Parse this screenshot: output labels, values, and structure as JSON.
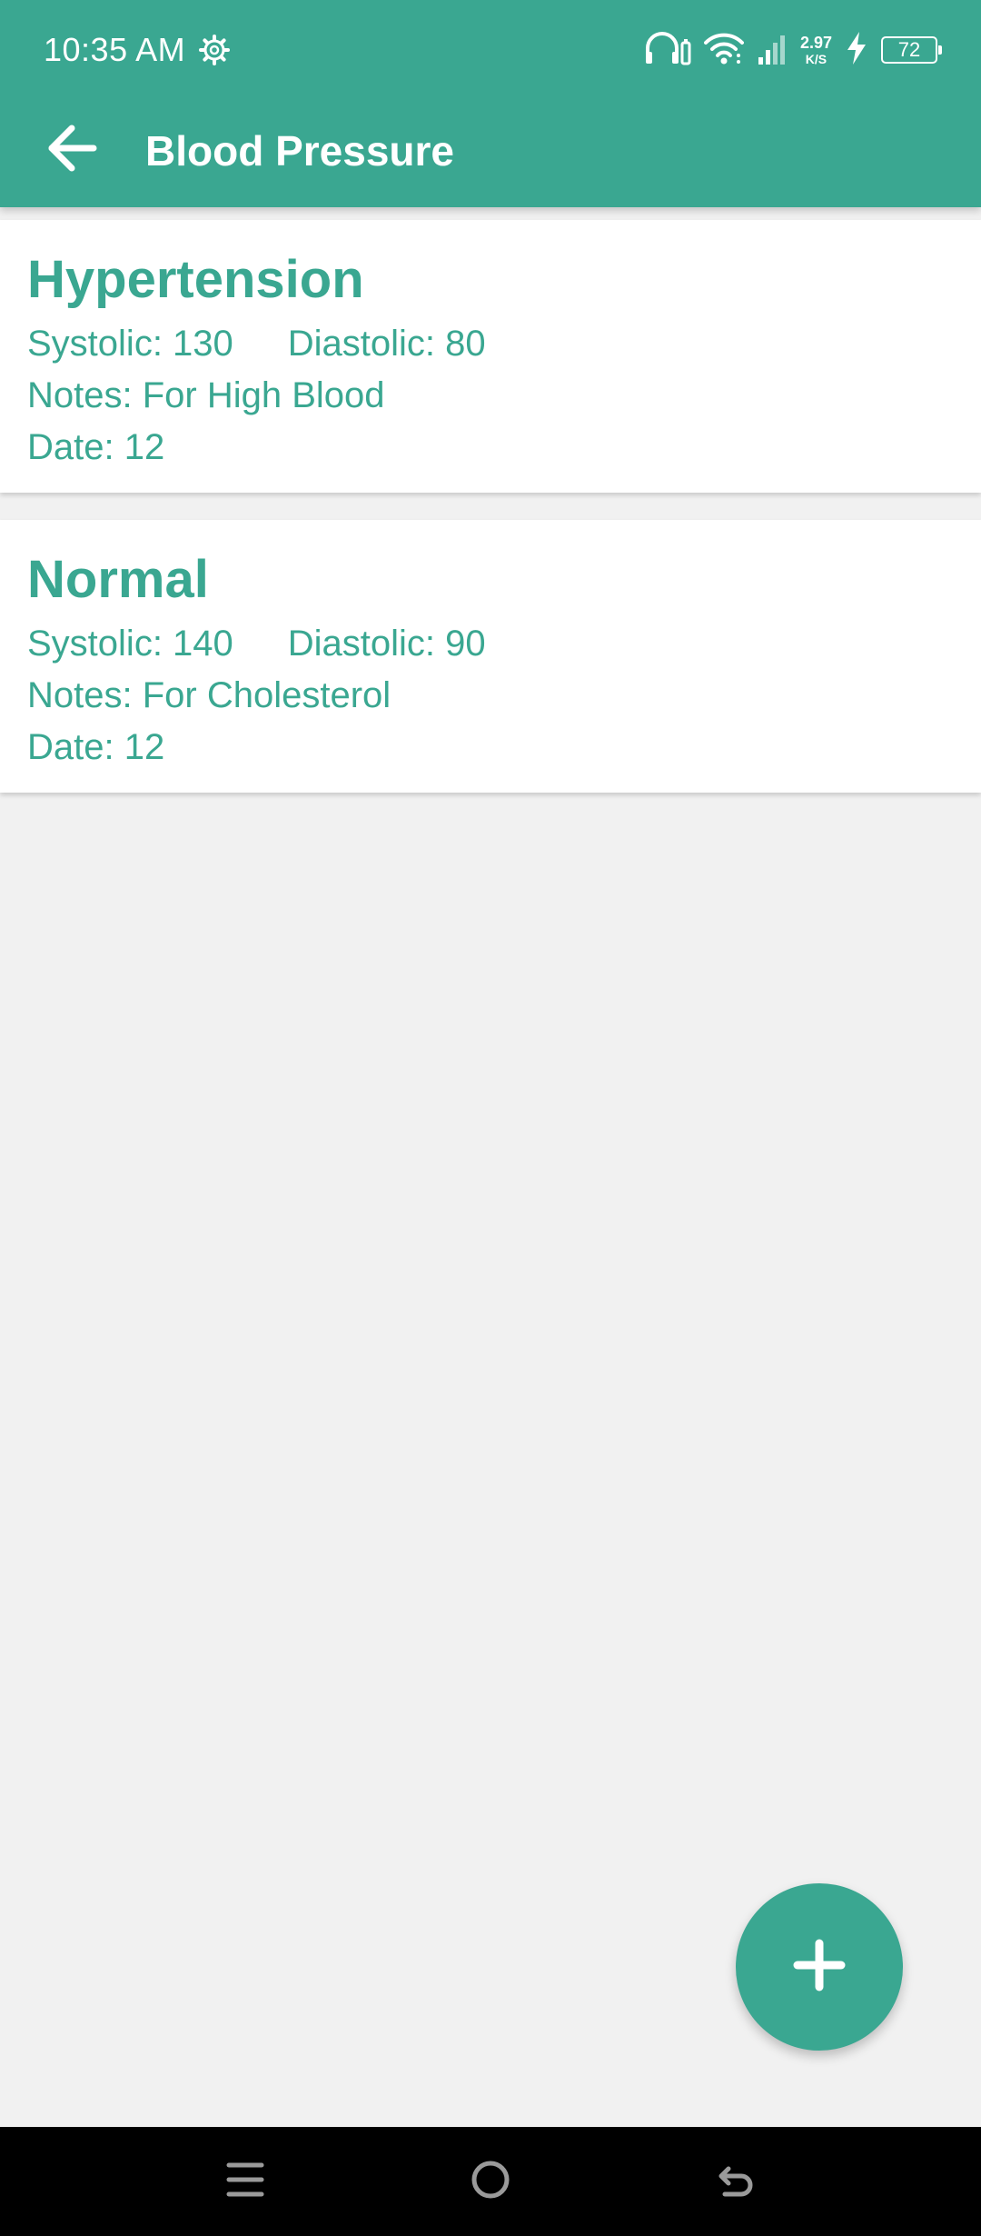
{
  "status_bar": {
    "time": "10:35 AM",
    "net_speed_value": "2.97",
    "net_speed_unit": "K/S",
    "battery_level": "72"
  },
  "toolbar": {
    "title": "Blood Pressure"
  },
  "records": [
    {
      "title": "Hypertension",
      "systolic": "Systolic: 130",
      "diastolic": "Diastolic: 80",
      "notes": "Notes: For High Blood",
      "date": "Date: 12"
    },
    {
      "title": "Normal",
      "systolic": "Systolic: 140",
      "diastolic": "Diastolic: 90",
      "notes": "Notes: For Cholesterol",
      "date": "Date: 12"
    }
  ],
  "colors": {
    "primary": "#3aa791",
    "background": "#f1f1f1",
    "card": "#ffffff",
    "nav_bar": "#000000"
  },
  "icons": {
    "status": [
      "gear-icon",
      "headphones-icon",
      "wifi-icon",
      "signal-icon",
      "charging-icon",
      "battery-icon"
    ],
    "toolbar": "back-arrow-icon",
    "fab": "plus-icon",
    "nav": [
      "menu-icon",
      "home-icon",
      "back-icon"
    ]
  }
}
